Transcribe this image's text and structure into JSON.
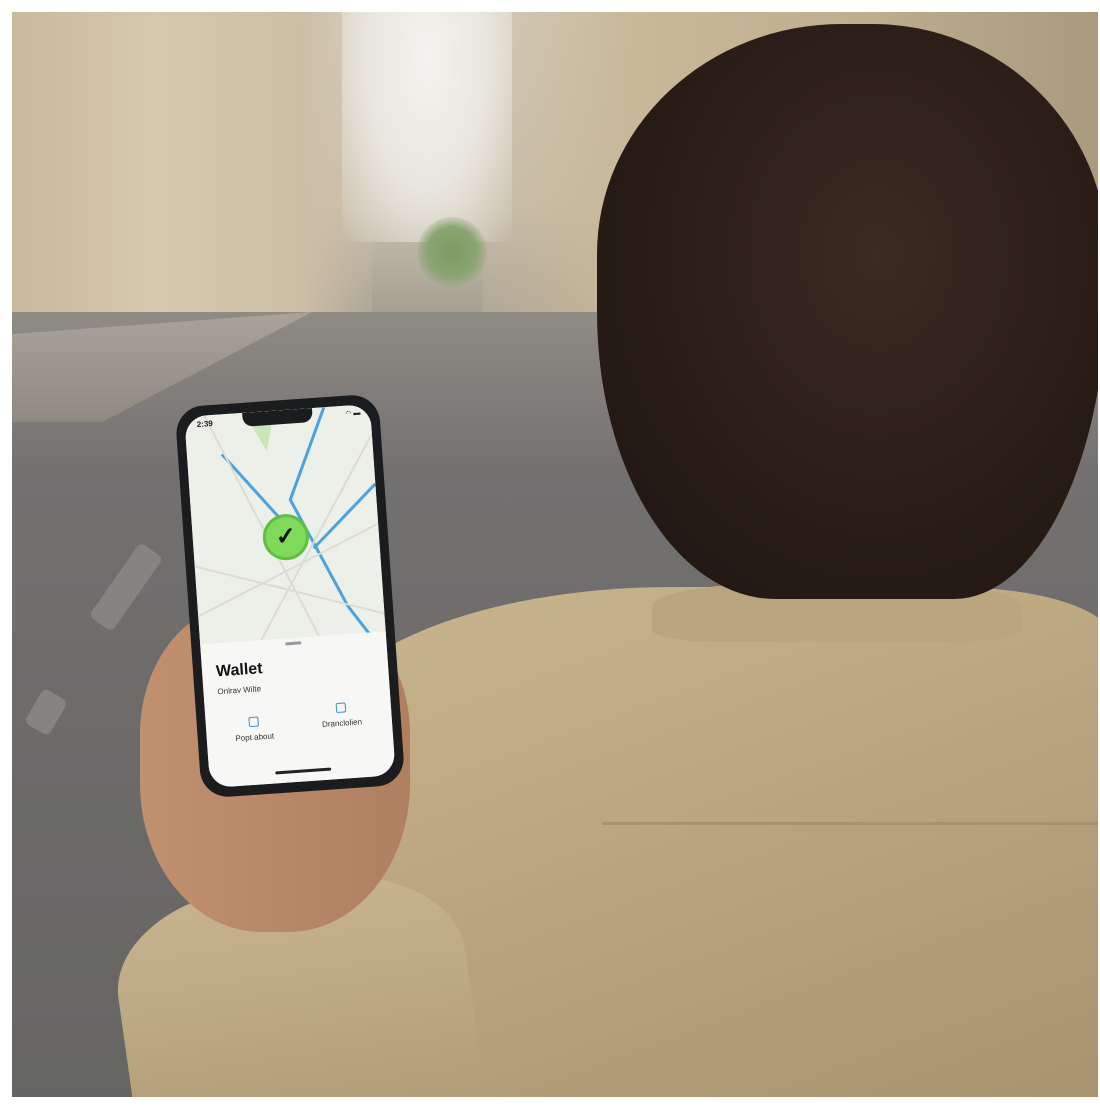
{
  "scene": {
    "description_colors": {
      "phone_accent": "#7fd95a",
      "map_route": "#4aa3e0",
      "jacket": "#bca781",
      "hair": "#2a1d17"
    }
  },
  "phone": {
    "status": {
      "time": "2:39",
      "icons": "wifi-icon battery-icon"
    },
    "map": {
      "marker_icon": "checkmark-icon"
    },
    "sheet": {
      "title": "Wallet",
      "subtitle": "Onlrav Wilte",
      "actions": [
        {
          "label": "Popt about",
          "icon": "pin-icon"
        },
        {
          "label": "Dranclolien",
          "icon": "directions-icon"
        }
      ]
    }
  }
}
